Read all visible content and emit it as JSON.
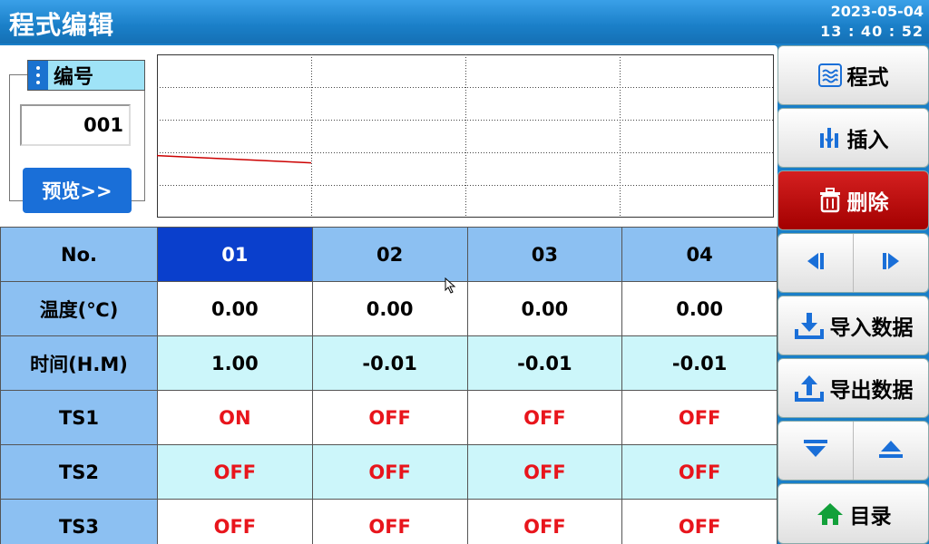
{
  "header": {
    "title": "程式编辑",
    "date": "2023-05-04",
    "time": "13 : 40 : 52"
  },
  "program": {
    "label": "编号",
    "number": "001",
    "preview_label": "预览>>"
  },
  "chart_data": {
    "type": "line",
    "series": [
      {
        "x": [
          0,
          1
        ],
        "y": [
          0.0,
          -0.01
        ]
      }
    ],
    "grid": true
  },
  "table": {
    "columns": [
      "No.",
      "01",
      "02",
      "03",
      "04"
    ],
    "selected_column": "01",
    "rows": [
      {
        "label": "温度(℃)",
        "values": [
          "0.00",
          "0.00",
          "0.00",
          "0.00"
        ]
      },
      {
        "label": "时间(H.M)",
        "values": [
          "1.00",
          "-0.01",
          "-0.01",
          "-0.01"
        ]
      },
      {
        "label": "TS1",
        "values": [
          "ON",
          "OFF",
          "OFF",
          "OFF"
        ]
      },
      {
        "label": "TS2",
        "values": [
          "OFF",
          "OFF",
          "OFF",
          "OFF"
        ]
      },
      {
        "label": "TS3",
        "values": [
          "OFF",
          "OFF",
          "OFF",
          "OFF"
        ]
      }
    ]
  },
  "sidebar": {
    "program_label": "程式",
    "insert_label": "插入",
    "delete_label": "删除",
    "import_label": "导入数据",
    "export_label": "导出数据",
    "menu_label": "目录"
  },
  "colors": {
    "accent": "#1a7fc8",
    "selected": "#0a3fcc",
    "delete": "#c01010",
    "state_text": "#e8151c"
  },
  "icons": [
    "program-icon",
    "insert-icon",
    "trash-icon",
    "step-left-icon",
    "step-right-icon",
    "import-icon",
    "export-icon",
    "arrow-down-icon",
    "arrow-up-icon",
    "home-icon"
  ]
}
